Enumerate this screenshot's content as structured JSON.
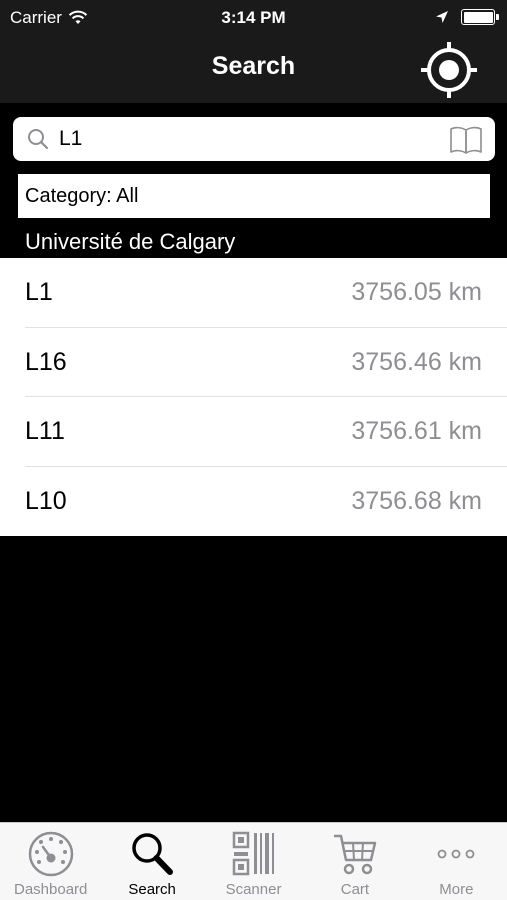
{
  "status_bar": {
    "carrier": "Carrier",
    "time": "3:14 PM"
  },
  "nav": {
    "title": "Search",
    "locate_icon": "crosshair-locate-icon"
  },
  "search": {
    "value": "L1",
    "icon": "search-icon",
    "book_icon": "book-icon"
  },
  "category": {
    "label": "Category: All"
  },
  "campus": {
    "name": "Université de Calgary"
  },
  "results": [
    {
      "name": "L1",
      "distance": "3756.05 km"
    },
    {
      "name": "L16",
      "distance": "3756.46 km"
    },
    {
      "name": "L11",
      "distance": "3756.61 km"
    },
    {
      "name": "L10",
      "distance": "3756.68 km"
    }
  ],
  "tabs": [
    {
      "label": "Dashboard",
      "icon": "dashboard-icon",
      "active": false
    },
    {
      "label": "Search",
      "icon": "search-icon",
      "active": true
    },
    {
      "label": "Scanner",
      "icon": "barcode-icon",
      "active": false
    },
    {
      "label": "Cart",
      "icon": "cart-icon",
      "active": false
    },
    {
      "label": "More",
      "icon": "more-icon",
      "active": false
    }
  ],
  "colors": {
    "active_tab": "#000000",
    "inactive_tab": "#8e8e93",
    "distance_text": "#8e8e93"
  }
}
